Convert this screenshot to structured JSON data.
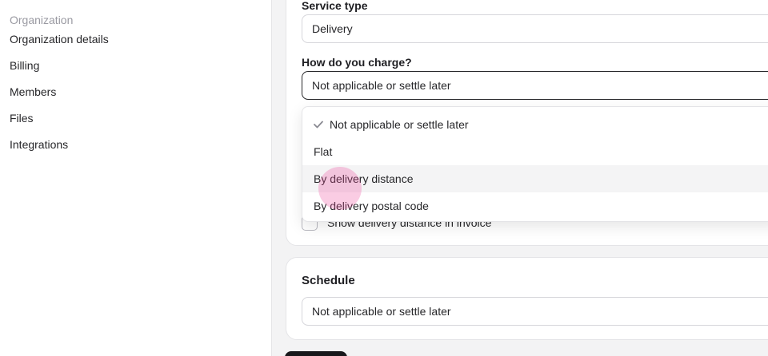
{
  "sidebar": {
    "section_label": "Organization",
    "items": [
      {
        "label": "Organization details"
      },
      {
        "label": "Billing"
      },
      {
        "label": "Members"
      },
      {
        "label": "Files"
      },
      {
        "label": "Integrations"
      }
    ]
  },
  "service_type": {
    "label": "Service type",
    "value": "Delivery"
  },
  "charge": {
    "label": "How do you charge?",
    "value": "Not applicable or settle later",
    "options": [
      {
        "label": "Not applicable or settle later",
        "selected": true
      },
      {
        "label": "Flat"
      },
      {
        "label": "By delivery distance",
        "hovered": true
      },
      {
        "label": "By delivery postal code"
      }
    ]
  },
  "invoice_option": {
    "label": "Show delivery distance in invoice"
  },
  "schedule": {
    "title": "Schedule",
    "value": "Not applicable or settle later"
  },
  "colors": {
    "accent": "#18181b",
    "click_indicator": "#ec4899"
  }
}
